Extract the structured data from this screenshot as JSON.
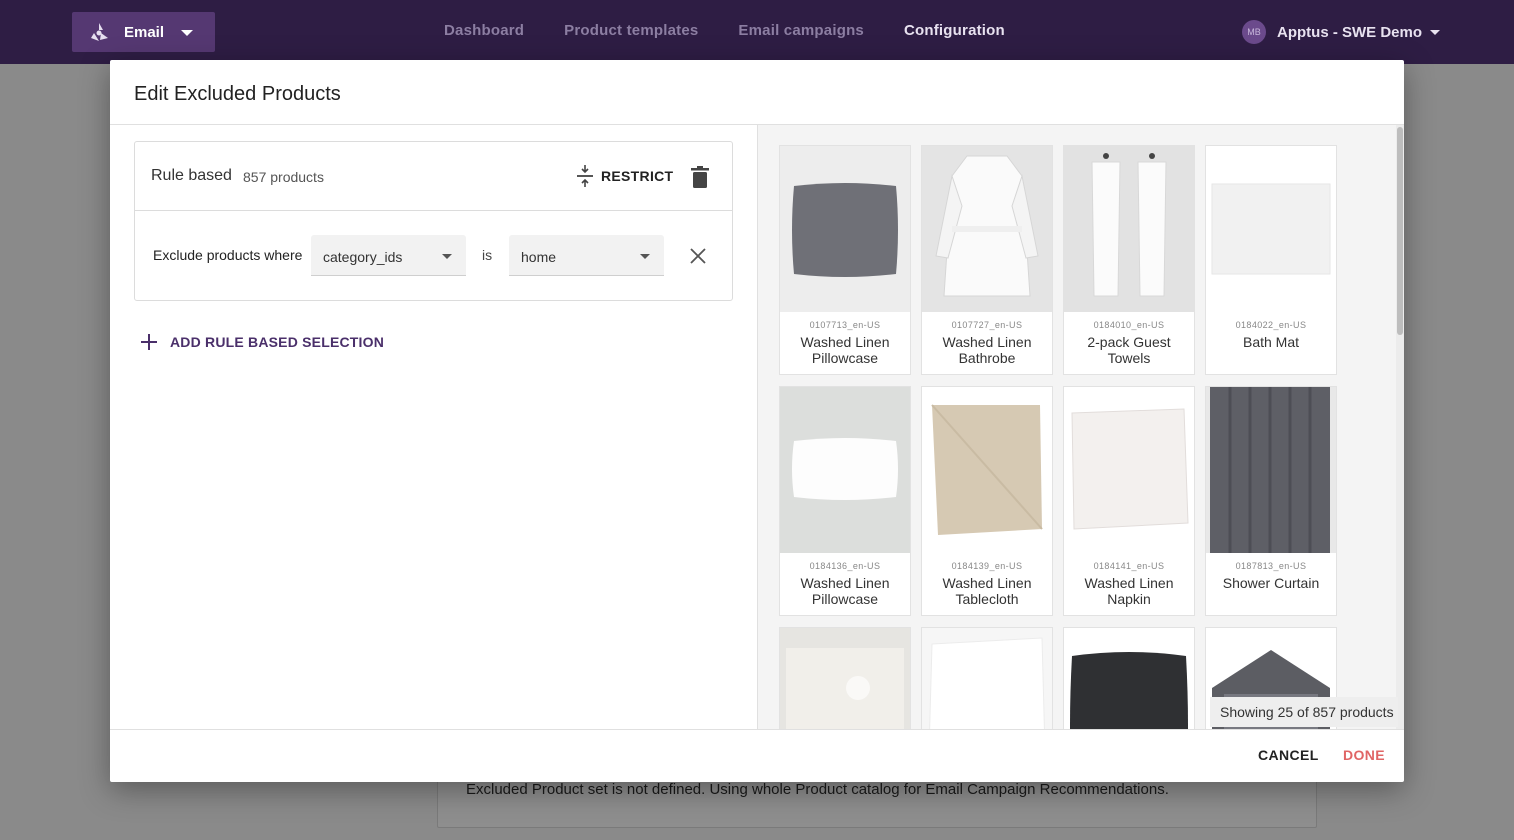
{
  "header": {
    "app_label": "Email",
    "nav": [
      "Dashboard",
      "Product templates",
      "Email campaigns",
      "Configuration"
    ],
    "active_nav": "Configuration",
    "account_initials": "MB",
    "account_name": "Apptus - SWE Demo"
  },
  "background": {
    "message": "Excluded Product set is not defined. Using whole Product catalog for Email Campaign Recommendations."
  },
  "modal": {
    "title": "Edit Excluded Products",
    "rule": {
      "title": "Rule based",
      "count": "857 products",
      "restrict_label": "RESTRICT",
      "exclude_label": "Exclude products where",
      "field_value": "category_ids",
      "operator": "is",
      "value": "home"
    },
    "add_rule_label": "ADD RULE BASED SELECTION",
    "showing": "Showing 25 of 857 products",
    "cancel_label": "CANCEL",
    "done_label": "DONE",
    "colors": {
      "accent": "#4a2f6a",
      "done": "#e06565",
      "topbar": "#2e1d44"
    },
    "products": [
      {
        "sku": "0107713_en-US",
        "name": "Washed Linen Pillowcase",
        "icon": "grey-pillow-image"
      },
      {
        "sku": "0107727_en-US",
        "name": "Washed Linen Bathrobe",
        "icon": "white-bathrobe-image"
      },
      {
        "sku": "0184010_en-US",
        "name": "2-pack Guest Towels",
        "icon": "hanging-towels-image"
      },
      {
        "sku": "0184022_en-US",
        "name": "Bath Mat",
        "icon": "white-bathmat-image"
      },
      {
        "sku": "0184136_en-US",
        "name": "Washed Linen Pillowcase",
        "icon": "white-pillow-image"
      },
      {
        "sku": "0184139_en-US",
        "name": "Washed Linen Tablecloth",
        "icon": "beige-tablecloth-image"
      },
      {
        "sku": "0184141_en-US",
        "name": "Washed Linen Napkin",
        "icon": "white-napkin-image"
      },
      {
        "sku": "0187813_en-US",
        "name": "Shower Curtain",
        "icon": "grey-curtain-image"
      },
      {
        "sku": "",
        "name": "",
        "icon": "linen-bed-image"
      },
      {
        "sku": "",
        "name": "",
        "icon": "white-bedding-image"
      },
      {
        "sku": "",
        "name": "",
        "icon": "dark-cushion-image"
      },
      {
        "sku": "",
        "name": "",
        "icon": "house-shelf-image"
      }
    ]
  }
}
